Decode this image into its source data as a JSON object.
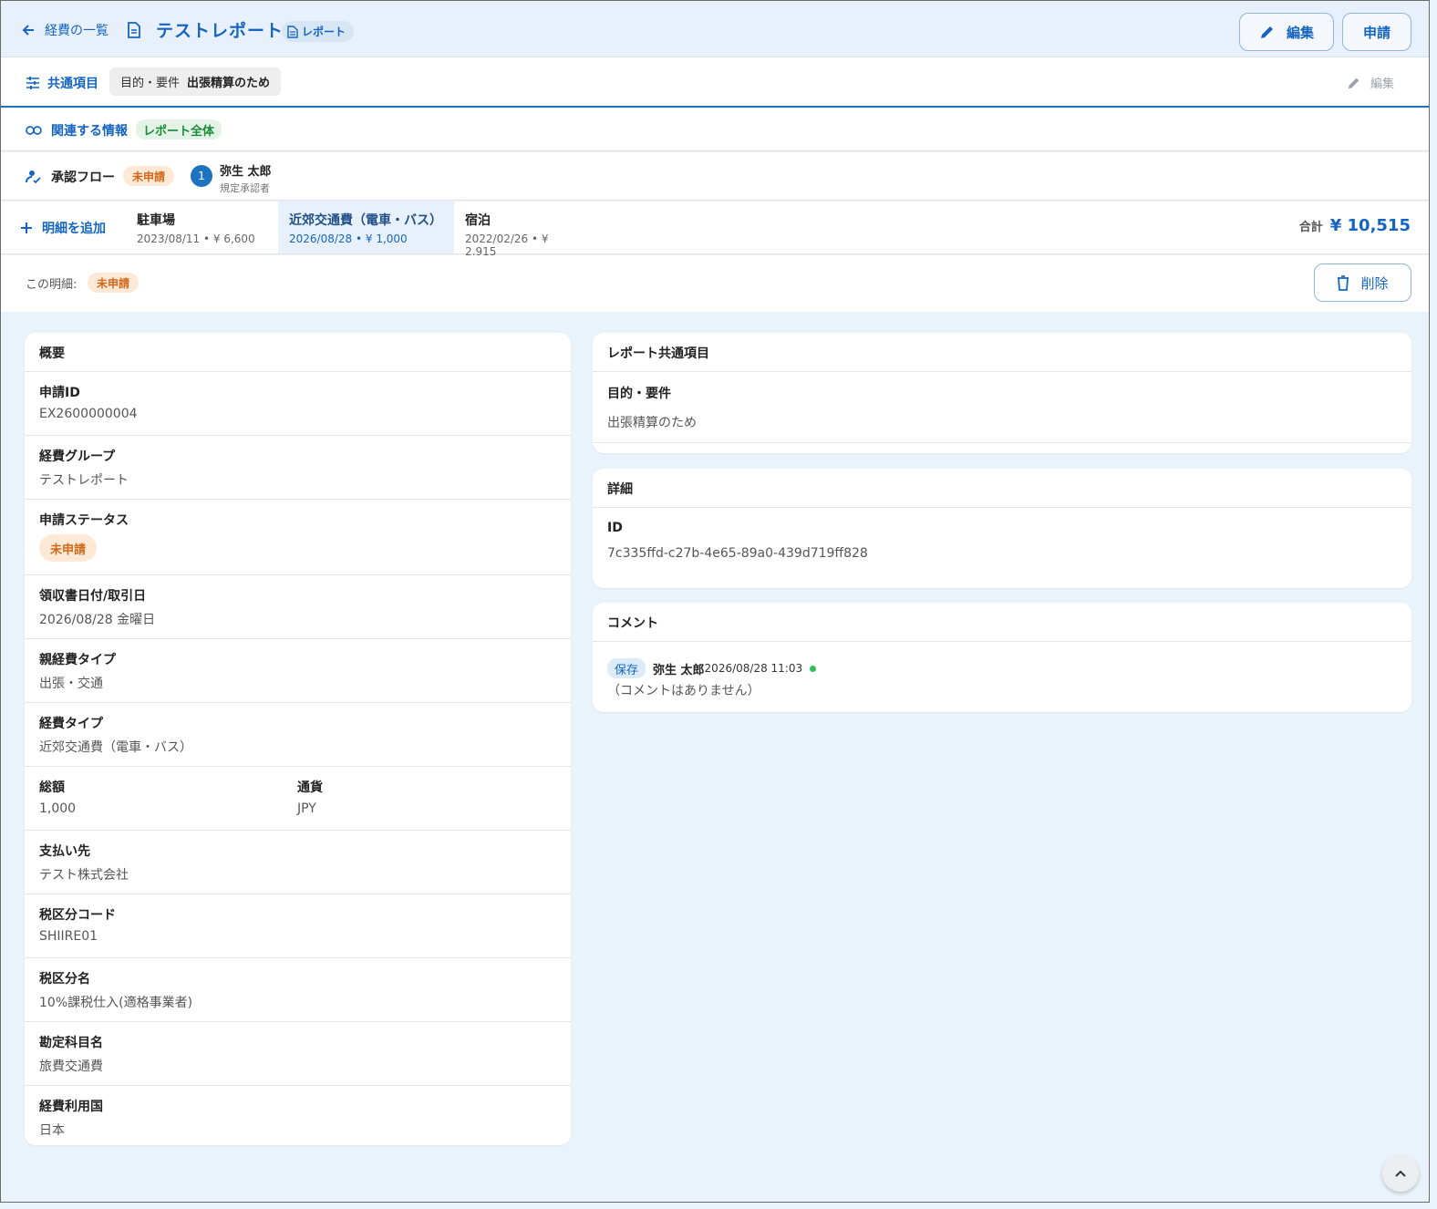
{
  "header": {
    "back_label": "経費の一覧",
    "report_title": "テストレポート",
    "report_chip": "レポート",
    "edit_label": "編集",
    "apply_label": "申請"
  },
  "common": {
    "label": "共通項目",
    "chip_key": "目的・要件",
    "chip_value": "出張精算のため",
    "edit_label": "編集"
  },
  "related": {
    "label": "関連する情報",
    "chip": "レポート全体"
  },
  "approval": {
    "label": "承認フロー",
    "status": "未申請",
    "step_number": "1",
    "approver_name": "弥生 太郎",
    "approver_role": "規定承認者"
  },
  "details_bar": {
    "add_label": "明細を追加",
    "items": [
      {
        "title": "駐車場",
        "sub": "2023/08/11 • ¥ 6,600"
      },
      {
        "title": "近郊交通費（電車・バス）",
        "sub": "2026/08/28 • ¥ 1,000"
      },
      {
        "title": "宿泊",
        "sub": "2022/02/26 • ¥ 2,915"
      }
    ],
    "total_label": "合計",
    "total_value": "¥ 10,515"
  },
  "this_detail": {
    "label": "この明細:",
    "status": "未申請",
    "delete_label": "削除"
  },
  "overview": {
    "title": "概要",
    "fields": [
      {
        "label": "申請ID",
        "value": "EX2600000004"
      },
      {
        "label": "経費グループ",
        "value": "テストレポート"
      },
      {
        "label": "申請ステータス",
        "value": "未申請"
      },
      {
        "label": "領収書日付/取引日",
        "value": "2026/08/28 金曜日"
      },
      {
        "label": "親経費タイプ",
        "value": "出張・交通"
      },
      {
        "label": "経費タイプ",
        "value": "近郊交通費（電車・バス）"
      },
      {
        "label": "総額",
        "value": "1,000"
      },
      {
        "label": "通貨",
        "value": "JPY"
      },
      {
        "label": "支払い先",
        "value": "テスト株式会社"
      },
      {
        "label": "税区分コード",
        "value": "SHIIRE01"
      },
      {
        "label": "税区分名",
        "value": "10%課税仕入(適格事業者)"
      },
      {
        "label": "勘定科目名",
        "value": "旅費交通費"
      },
      {
        "label": "経費利用国",
        "value": "日本"
      }
    ]
  },
  "report_common": {
    "title": "レポート共通項目",
    "label": "目的・要件",
    "value": "出張精算のため"
  },
  "detail_card": {
    "title": "詳細",
    "label": "ID",
    "value": "7c335ffd-c27b-4e65-89a0-439d719ff828"
  },
  "comments": {
    "title": "コメント",
    "badge": "保存",
    "author": "弥生 太郎",
    "timestamp": "2026/08/28 11:03",
    "empty_text": "（コメントはありません）"
  },
  "colors": {
    "accent": "#1565c0",
    "background": "#eaf2fb",
    "status_orange": "#d2671a",
    "status_green": "#1b8a3b"
  },
  "icons": [
    "arrow-left-icon",
    "document-icon",
    "pencil-icon",
    "sliders-icon",
    "link-icon",
    "person-check-icon",
    "plus-icon",
    "trash-icon",
    "chevron-up-icon"
  ]
}
